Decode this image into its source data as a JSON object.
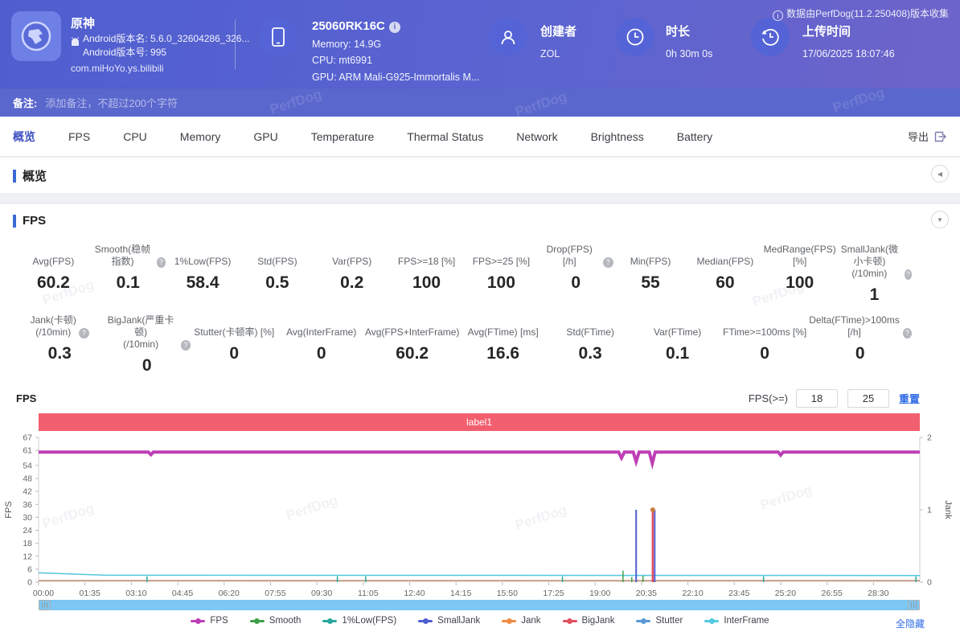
{
  "watermark": "PerfDog",
  "header": {
    "app": {
      "name": "原神",
      "version_name": "Android版本名: 5.6.0_32604286_326...",
      "version_code": "Android版本号: 995",
      "package": "com.miHoYo.ys.bilibili"
    },
    "device": {
      "name": "25060RK16C",
      "memory": "Memory: 14.9G",
      "cpu": "CPU: mt6991",
      "gpu": "GPU: ARM Mali-G925-Immortalis M..."
    },
    "creator": {
      "label": "创建者",
      "value": "ZOL"
    },
    "duration": {
      "label": "时长",
      "value": "0h 30m 0s"
    },
    "upload": {
      "label": "上传时间",
      "value": "17/06/2025 18:07:46"
    },
    "collect_note": "数据由PerfDog(11.2.250408)版本收集"
  },
  "remark": {
    "label": "备注:",
    "placeholder": "添加备注，不超过200个字符"
  },
  "tabs": [
    "概览",
    "FPS",
    "CPU",
    "Memory",
    "GPU",
    "Temperature",
    "Thermal Status",
    "Network",
    "Brightness",
    "Battery"
  ],
  "active_tab": 0,
  "export_label": "导出",
  "sections": {
    "overview_title": "概览",
    "fps_title": "FPS"
  },
  "stats_row1": [
    {
      "label": "Avg(FPS)",
      "value": "60.2"
    },
    {
      "label": "Smooth(稳帧指数)",
      "value": "0.1",
      "help": true
    },
    {
      "label": "1%Low(FPS)",
      "value": "58.4"
    },
    {
      "label": "Std(FPS)",
      "value": "0.5"
    },
    {
      "label": "Var(FPS)",
      "value": "0.2"
    },
    {
      "label": "FPS>=18 [%]",
      "value": "100"
    },
    {
      "label": "FPS>=25 [%]",
      "value": "100"
    },
    {
      "label": "Drop(FPS) [/h]",
      "value": "0",
      "help": true
    },
    {
      "label": "Min(FPS)",
      "value": "55"
    },
    {
      "label": "Median(FPS)",
      "value": "60"
    },
    {
      "label": "MedRange(FPS)[%]",
      "value": "100"
    },
    {
      "label": "SmallJank(微小卡顿)\n(/10min)",
      "value": "1",
      "help": true
    }
  ],
  "stats_row2": [
    {
      "label": "Jank(卡顿)\n(/10min)",
      "value": "0.3",
      "help": true
    },
    {
      "label": "BigJank(严重卡顿)\n(/10min)",
      "value": "0",
      "help": true
    },
    {
      "label": "Stutter(卡顿率) [%]",
      "value": "0"
    },
    {
      "label": "Avg(InterFrame)",
      "value": "0"
    },
    {
      "label": "Avg(FPS+InterFrame)",
      "value": "60.2"
    },
    {
      "label": "Avg(FTime) [ms]",
      "value": "16.6"
    },
    {
      "label": "Std(FTime)",
      "value": "0.3"
    },
    {
      "label": "Var(FTime)",
      "value": "0.1"
    },
    {
      "label": "FTime>=100ms [%]",
      "value": "0"
    },
    {
      "label": "Delta(FTime)>100ms [/h]",
      "value": "0",
      "help": true
    }
  ],
  "fps_chart": {
    "title": "FPS",
    "threshold_label": "FPS(>=)",
    "threshold1": "18",
    "threshold2": "25",
    "reset_label": "重置",
    "hide_all_label": "全隐藏"
  },
  "chart_data": {
    "type": "line",
    "title": "label1",
    "banner_color": "#f25f6f",
    "x": {
      "ticks": [
        "00:00",
        "01:35",
        "03:10",
        "04:45",
        "06:20",
        "07:55",
        "09:30",
        "11:05",
        "12:40",
        "14:15",
        "15:50",
        "17:25",
        "19:00",
        "20:35",
        "22:10",
        "23:45",
        "25:20",
        "26:55",
        "28:30"
      ],
      "tick_interval_s": 95,
      "total_s": 1805
    },
    "y_left": {
      "label": "FPS",
      "ticks": [
        0,
        6,
        12,
        18,
        24,
        30,
        36,
        42,
        48,
        54,
        61,
        67
      ],
      "min": 0,
      "max": 67
    },
    "y_right": {
      "label": "Jank",
      "ticks": [
        0,
        1,
        2
      ],
      "min": 0,
      "max": 2
    },
    "series": [
      {
        "name": "FPS",
        "color": "#bd3fb5",
        "axis": "left",
        "type": "line",
        "width": 4,
        "points": [
          [
            0,
            60.2
          ],
          [
            225,
            60.2
          ],
          [
            230,
            59
          ],
          [
            235,
            60.2
          ],
          [
            1188,
            60.2
          ],
          [
            1194,
            57.5
          ],
          [
            1200,
            60.2
          ],
          [
            1218,
            60.2
          ],
          [
            1224,
            55.8
          ],
          [
            1230,
            60.2
          ],
          [
            1251,
            60.2
          ],
          [
            1257,
            55
          ],
          [
            1263,
            60.2
          ],
          [
            1515,
            60.2
          ],
          [
            1520,
            58.8
          ],
          [
            1525,
            60.2
          ],
          [
            1805,
            60.2
          ]
        ]
      },
      {
        "name": "InterFrame",
        "color": "#53c8de",
        "axis": "left",
        "type": "line",
        "width": 1.5,
        "points": [
          [
            0,
            4.3
          ],
          [
            140,
            3.2
          ],
          [
            1805,
            3.1
          ]
        ]
      },
      {
        "name": "JankBaseline",
        "color": "#c49b85",
        "axis": "right",
        "type": "line",
        "width": 2,
        "points": [
          [
            0,
            0.02
          ],
          [
            1805,
            0.02
          ]
        ]
      },
      {
        "name": "Smooth",
        "color": "#3fa04c",
        "axis": "right",
        "type": "impulse",
        "width": 1.5,
        "events": [
          [
            1197,
            0.16
          ],
          [
            1215,
            0.07
          ],
          [
            1238,
            0.09
          ]
        ]
      },
      {
        "name": "1%Low(FPS)",
        "color": "#2aa79b",
        "axis": "right",
        "type": "impulse",
        "width": 1.5,
        "events": [
          [
            222,
            0.08
          ],
          [
            612,
            0.08
          ],
          [
            670,
            0.08
          ],
          [
            1073,
            0.08
          ],
          [
            1485,
            0.08
          ],
          [
            1797,
            0.08
          ]
        ]
      },
      {
        "name": "SmallJank",
        "color": "#4f5ed2",
        "axis": "right",
        "type": "impulse",
        "width": 2,
        "events": [
          [
            1224,
            1
          ],
          [
            1262,
            1
          ]
        ]
      },
      {
        "name": "Jank",
        "color": "#e0515f",
        "axis": "right",
        "type": "impulse",
        "width": 2.5,
        "cap": true,
        "cap_color": "#c9803f",
        "events": [
          [
            1258,
            1
          ]
        ]
      }
    ],
    "legend": [
      {
        "name": "FPS",
        "color": "#bd3fb5"
      },
      {
        "name": "Smooth",
        "color": "#3fa04c"
      },
      {
        "name": "1%Low(FPS)",
        "color": "#2aa79b"
      },
      {
        "name": "SmallJank",
        "color": "#4f5ed2"
      },
      {
        "name": "Jank",
        "color": "#ef8c43"
      },
      {
        "name": "BigJank",
        "color": "#e0515f"
      },
      {
        "name": "Stutter",
        "color": "#5b9bd5"
      },
      {
        "name": "InterFrame",
        "color": "#53c8de"
      }
    ]
  }
}
